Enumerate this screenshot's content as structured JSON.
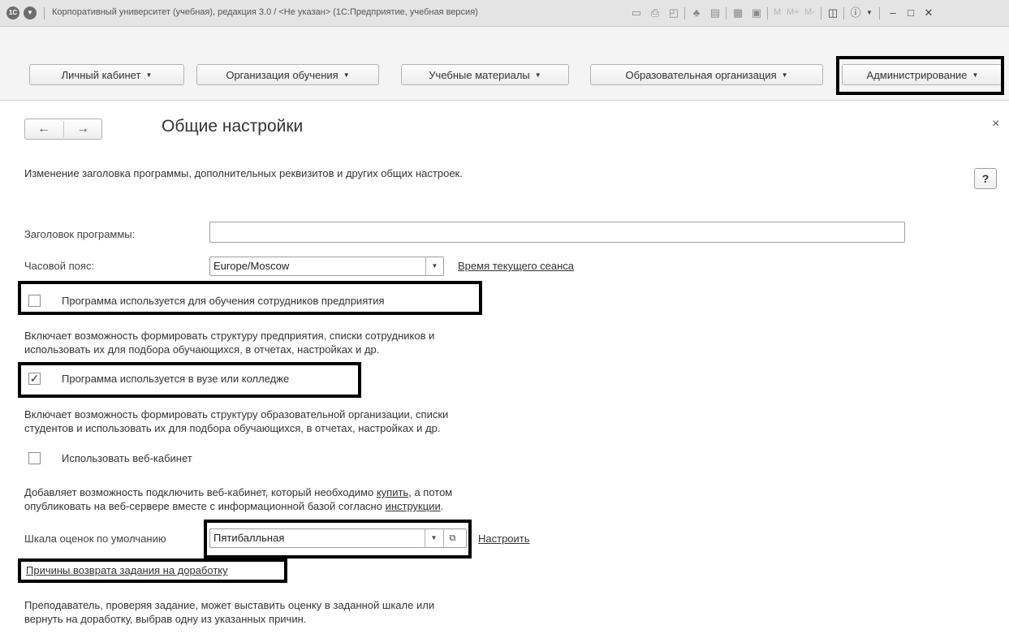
{
  "window": {
    "title": "Корпоративный университет (учебная), редакция 3.0 / <Не указан>  (1С:Предприятие, учебная версия)",
    "logo_text": "1С",
    "m_buttons": [
      "M",
      "M+",
      "M-"
    ]
  },
  "sections": [
    {
      "label": "Личный кабинет"
    },
    {
      "label": "Организация обучения"
    },
    {
      "label": "Учебные материалы"
    },
    {
      "label": "Образовательная организация"
    },
    {
      "label": "Администрирование"
    }
  ],
  "page": {
    "title": "Общие настройки",
    "description": "Изменение заголовка программы, дополнительных реквизитов и других общих настроек.",
    "help": "?",
    "close": "×"
  },
  "form": {
    "program_title_label": "Заголовок программы:",
    "program_title_value": "",
    "timezone_label": "Часовой пояс:",
    "timezone_value": "Europe/Moscow",
    "session_time_link": "Время текущего сеанса",
    "employees_checkbox": {
      "label": "Программа используется для обучения сотрудников предприятия",
      "checked": false
    },
    "employees_hint_1": "Включает возможность формировать структуру предприятия, списки сотрудников и",
    "employees_hint_2": "использовать их для подбора обучающихся, в отчетах, настройках и др.",
    "college_checkbox": {
      "label": "Программа используется в вузе или колледже",
      "checked": true
    },
    "college_hint_1": "Включает возможность формировать структуру образовательной организации, списки",
    "college_hint_2": "студентов и использовать их для подбора обучающихся, в отчетах, настройках и др.",
    "webcab_checkbox": {
      "label": "Использовать веб-кабинет",
      "checked": false
    },
    "webcab_hint_1a": "Добавляет возможность подключить веб-кабинет, который необходимо ",
    "webcab_hint_1_link": "купить",
    "webcab_hint_1b": ", а потом",
    "webcab_hint_2a": "опубликовать на веб-сервере вместе с информационной базой согласно ",
    "webcab_hint_2_link": "инструкции",
    "webcab_hint_2b": ".",
    "grade_scale_label": "Шкала оценок по умолчанию",
    "grade_scale_value": "Пятибалльная",
    "configure_link": "Настроить",
    "return_reasons_link": "Причины возврата задания на доработку",
    "return_hint_1": "Преподаватель, проверяя задание, может выставить оценку в заданной шкале или",
    "return_hint_2": "вернуть на доработку, выбрав одну из указанных причин."
  }
}
